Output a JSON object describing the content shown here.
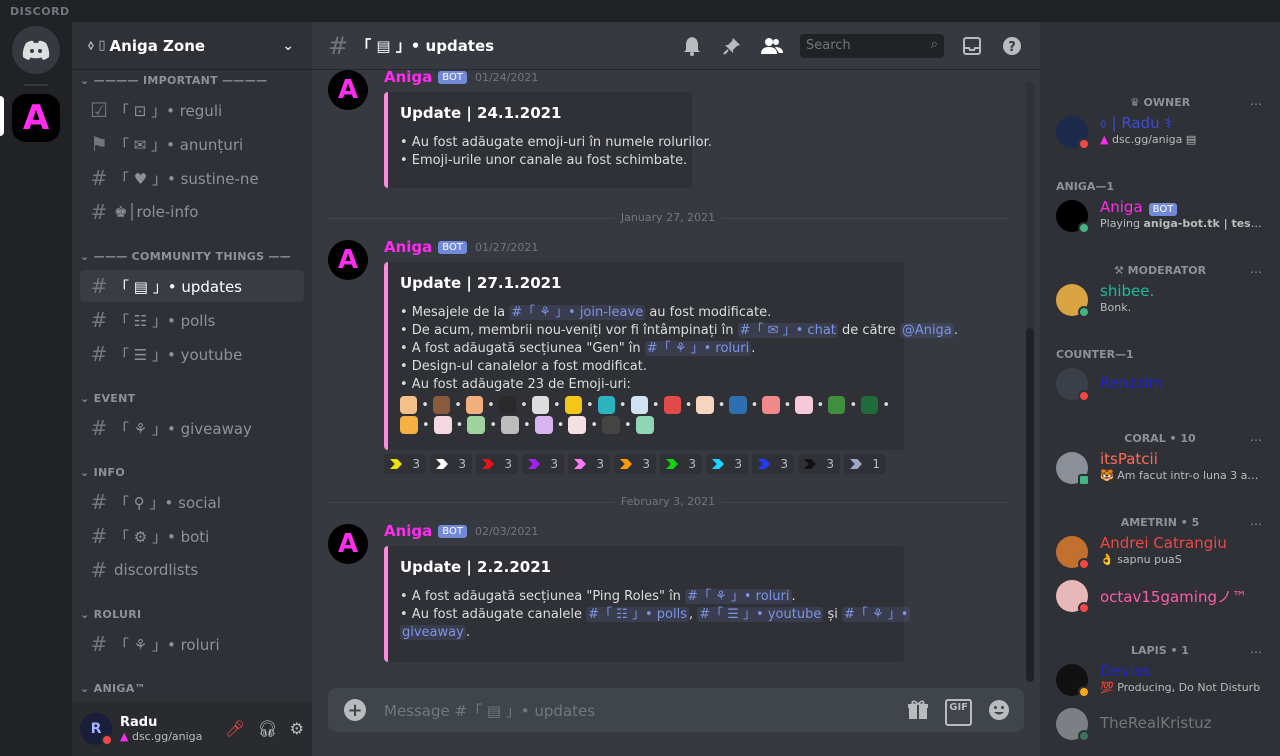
{
  "titlebar": {
    "brand": "DISCORD"
  },
  "server": {
    "name": "Aniga Zone",
    "prefix": "⬨ ▯"
  },
  "categories": {
    "important": "———— IMPORTANT ————",
    "community": "——— COMMUNITY THINGS ——",
    "event": "EVENT",
    "info": "INFO",
    "roluri": "ROLURI",
    "aniga": "ANIGA™"
  },
  "channels": {
    "reguli": "「 ⊡ 」• reguli",
    "anunturi": "「 ✉ 」• anunțuri",
    "sustine": "「 ♥ 」• sustine-ne",
    "roleinfo": "♚│role-info",
    "updates": "「 ▤ 」• updates",
    "polls": "「 ☷ 」• polls",
    "youtube": "「 ☰ 」• youtube",
    "giveaway": "「 ⚘ 」• giveaway",
    "social": "「 ⚲ 」• social",
    "boti": "「 ⚙ 」• boti",
    "discordlists": "discordlists",
    "roluriCh": "「 ⚘ 」• roluri"
  },
  "user": {
    "name": "Radu",
    "status": "dsc.gg/aniga",
    "initial": "R"
  },
  "header": {
    "channel": "「 ▤ 」• updates",
    "search_placeholder": "Search"
  },
  "messages": [
    {
      "author": "Aniga",
      "badge": "BOT",
      "time": "01/24/2021",
      "title": "Update | 24.1.2021",
      "lines": [
        "• Au fost adăugate emoji-uri în numele rolurilor.",
        "• Emoji-urile unor canale au fost schimbate."
      ]
    },
    {
      "author": "Aniga",
      "badge": "BOT",
      "time": "01/27/2021",
      "title": "Update | 27.1.2021",
      "l1a": "• Mesajele de la ",
      "l1m": "#「 ⚘ 」• join-leave",
      "l1b": " au fost modificate.",
      "l2a": "• De acum, membrii nou-veniți vor fi întâmpinați în ",
      "l2m": "#「 ✉ 」• chat",
      "l2b": " de către ",
      "l2m2": "@Aniga",
      "l2c": ".",
      "l3a": "• A fost adăugată secțiunea \"Gen\" în ",
      "l3m": "#「 ⚘ 」• roluri",
      "l3b": ".",
      "l4": "• Design-ul canalelor a fost modificat.",
      "l5": "• Au fost adăugate 23 de Emoji-uri:"
    },
    {
      "author": "Aniga",
      "badge": "BOT",
      "time": "02/03/2021",
      "title": "Update | 2.2.2021",
      "l1a": "• A fost adăugată secțiunea \"Ping Roles\" în ",
      "l1m": "#「 ⚘ 」• roluri",
      "l1b": ".",
      "l2a": "• Au fost adăugate canalele ",
      "l2m": "#「 ☷ 」• polls",
      "l2b": ", ",
      "l2m2": "#「 ☰ 」• youtube",
      "l2c": " și ",
      "l2m3": "#「 ⚘ 」•",
      "l3m": "giveaway",
      "l3b": "."
    }
  ],
  "dividers": [
    "January 27, 2021",
    "February 3, 2021"
  ],
  "reactions": [
    {
      "color": "#f5e100",
      "count": "3"
    },
    {
      "color": "#ffffff",
      "count": "3"
    },
    {
      "color": "#e8141b",
      "count": "3"
    },
    {
      "color": "#a020f0",
      "count": "3"
    },
    {
      "color": "#ff7cf2",
      "count": "3"
    },
    {
      "color": "#ff9a00",
      "count": "3"
    },
    {
      "color": "#14d314",
      "count": "3"
    },
    {
      "color": "#19d8ff",
      "count": "3"
    },
    {
      "color": "#1f3bff",
      "count": "3"
    },
    {
      "color": "#111111",
      "count": "3"
    },
    {
      "color": "#a0a8c8",
      "count": "1"
    }
  ],
  "composer": {
    "placeholder": "Message #「 ▤ 」• updates"
  },
  "members": {
    "owner_cat": "♛ OWNER",
    "owner": {
      "name": "⬨ | Radu ⚕",
      "status": "dsc.gg/aniga ▤"
    },
    "aniga_cat": "ANIGA—1",
    "aniga": {
      "name": "Aniga",
      "badge": "BOT",
      "status_a": "Playing ",
      "status_b": "aniga-bot.tk | testing."
    },
    "mod_cat": "⚒ MODERATOR",
    "mod": {
      "name": "shibee.",
      "status": "Bonk."
    },
    "counter_cat": "COUNTER—1",
    "counter": {
      "name": "Renzzim"
    },
    "coral_cat": "CORAL • 10",
    "coral": {
      "name": "itsPatcii",
      "status": "Am facut intr-o luna 3 ani de..."
    },
    "ametrin_cat": "AMETRIN • 5",
    "ametrin1": {
      "name": "Andrei Catrangiu",
      "status": "sapnu puaS"
    },
    "ametrin2": {
      "name": "octav15gamingノ™"
    },
    "lapis_cat": "LAPIS • 1",
    "lapis": {
      "name": "Devias",
      "status": "Producing, Do Not Disturb"
    },
    "last": {
      "name": "TheRealKristuz"
    }
  },
  "colors": {
    "accent": "#7289da",
    "aniga": "#ff2cf0",
    "embed_border": "#ff8ad8"
  }
}
